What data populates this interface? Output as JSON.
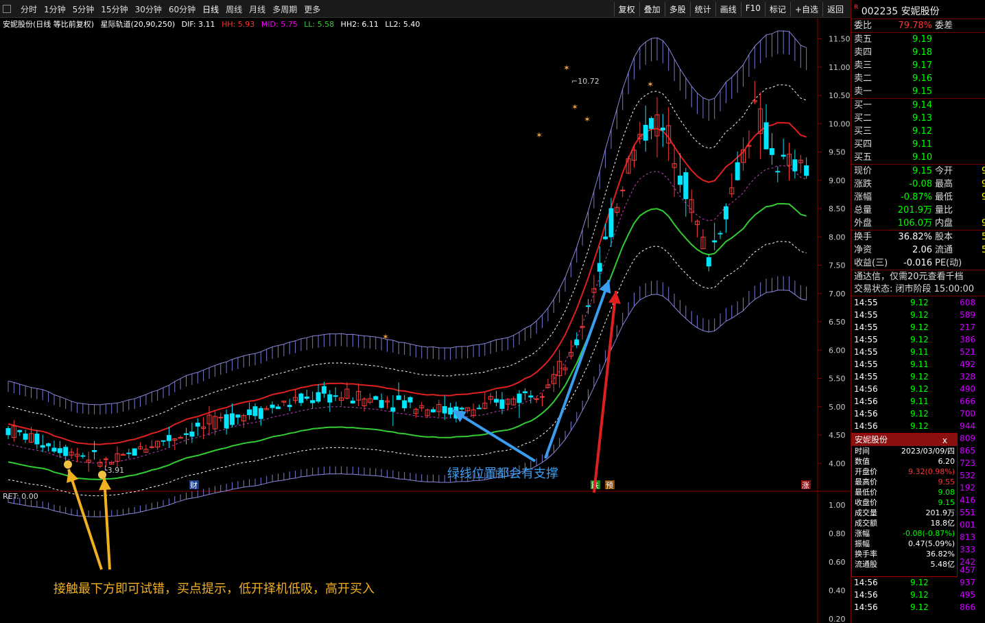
{
  "toolbar": {
    "periods": [
      "分时",
      "1分钟",
      "5分钟",
      "15分钟",
      "30分钟",
      "60分钟",
      "日线",
      "周线",
      "月线",
      "多周期",
      "更多"
    ],
    "right": [
      "复权",
      "叠加",
      "多股",
      "统计",
      "画线",
      "F10",
      "标记",
      "+自选",
      "返回"
    ]
  },
  "info": {
    "name": "安妮股份(日线 等比前复权)",
    "indicator": "星际轨道(20,90,250)",
    "dif": "DIF: 3.11",
    "hh": "HH: 5.93",
    "mid": "MID: 5.75",
    "ll": "LL: 5.58",
    "hh2": "HH2: 6.11",
    "ll2": "LL2: 5.40"
  },
  "colors": {
    "up": "#ff3b3b",
    "down": "#00e6ff",
    "red": "#e02020",
    "green": "#33cc33",
    "blue": "#3a9df0",
    "yellow": "#f0b020"
  },
  "chart_data": {
    "type": "candlestick",
    "y_ticks": [
      "11.50",
      "11.00",
      "10.50",
      "10.00",
      "9.50",
      "9.00",
      "8.50",
      "8.00",
      "7.50",
      "7.00",
      "6.50",
      "6.00",
      "5.50",
      "5.00",
      "4.50",
      "4.00"
    ],
    "ylim": [
      3.7,
      11.7
    ],
    "high_label": "10.72",
    "low_label": "3.91",
    "markers": [
      "财",
      "跌",
      "预",
      "涨"
    ],
    "sub_ticks": [
      "1.00",
      "0.80",
      "0.60",
      "0.40",
      "0.20"
    ],
    "sub_label": "RET: 0.00"
  },
  "annotations": {
    "support": "绿线位置都会有支撑",
    "buy": "接触最下方即可试错，买点提示，低开择机低吸，高开买入"
  },
  "quote": {
    "code": "002235",
    "name": "安妮股份",
    "r": "R",
    "wb_label": "委比",
    "wb": "79.78%",
    "wc_label": "委差",
    "asks": [
      {
        "l": "卖五",
        "v": "9.19"
      },
      {
        "l": "卖四",
        "v": "9.18"
      },
      {
        "l": "卖三",
        "v": "9.17"
      },
      {
        "l": "卖二",
        "v": "9.16"
      },
      {
        "l": "卖一",
        "v": "9.15"
      }
    ],
    "bids": [
      {
        "l": "买一",
        "v": "9.14"
      },
      {
        "l": "买二",
        "v": "9.13"
      },
      {
        "l": "买三",
        "v": "9.12"
      },
      {
        "l": "买四",
        "v": "9.11"
      },
      {
        "l": "买五",
        "v": "9.10"
      }
    ],
    "stats": [
      {
        "l": "现价",
        "v": "9.15",
        "l2": "今开",
        "v2": "9"
      },
      {
        "l": "涨跌",
        "v": "-0.08",
        "l2": "最高",
        "v2": "9"
      },
      {
        "l": "涨幅",
        "v": "-0.87%",
        "l2": "最低",
        "v2": "9"
      },
      {
        "l": "总量",
        "v": "201.9万",
        "l2": "量比",
        "v2": ""
      },
      {
        "l": "外盘",
        "v": "106.0万",
        "l2": "内盘",
        "v2": "9"
      }
    ],
    "stats2": [
      {
        "l": "换手",
        "v": "36.82%",
        "l2": "股本",
        "v2": "5"
      },
      {
        "l": "净资",
        "v": "2.06",
        "l2": "流通",
        "v2": "5"
      },
      {
        "l": "收益(三)",
        "v": "-0.016",
        "l2": "PE(动)",
        "v2": ""
      }
    ],
    "notice": "通达信，仅需20元查看千档",
    "status": "交易状态: 闭市阶段 15:00:00",
    "ticks": [
      [
        "14:55",
        "9.12",
        "608"
      ],
      [
        "14:55",
        "9.12",
        "589"
      ],
      [
        "14:55",
        "9.12",
        "217"
      ],
      [
        "14:55",
        "9.12",
        "386"
      ],
      [
        "14:55",
        "9.11",
        "521"
      ],
      [
        "14:55",
        "9.11",
        "492"
      ],
      [
        "14:55",
        "9.12",
        "328"
      ],
      [
        "14:56",
        "9.12",
        "490"
      ],
      [
        "14:56",
        "9.11",
        "666"
      ],
      [
        "14:56",
        "9.12",
        "700"
      ],
      [
        "14:56",
        "9.12",
        "944"
      ]
    ],
    "ticks2": [
      [
        "14:56",
        "9.12",
        "457"
      ],
      [
        "14:56",
        "9.12",
        "937"
      ],
      [
        "14:56",
        "9.12",
        "495"
      ],
      [
        "14:56",
        "9.12",
        "866"
      ]
    ],
    "sidevols": [
      "809",
      "865",
      "723",
      "532",
      "192",
      "416",
      "551",
      "001",
      "813",
      "333",
      "242"
    ]
  },
  "tooltip": {
    "title": "安妮股份",
    "close": "x",
    "rows": [
      [
        "时间",
        "2023/03/09/四"
      ],
      [
        "数值",
        "6.20"
      ],
      [
        "开盘价",
        "9.32(0.98%)"
      ],
      [
        "最高价",
        "9.55"
      ],
      [
        "最低价",
        "9.08"
      ],
      [
        "收盘价",
        "9.15"
      ],
      [
        "成交量",
        "201.9万"
      ],
      [
        "成交额",
        "18.8亿"
      ],
      [
        "涨幅",
        "-0.08(-0.87%)"
      ],
      [
        "振幅",
        "0.47(5.09%)"
      ],
      [
        "换手率",
        "36.82%"
      ],
      [
        "流通股",
        "5.48亿"
      ]
    ]
  }
}
